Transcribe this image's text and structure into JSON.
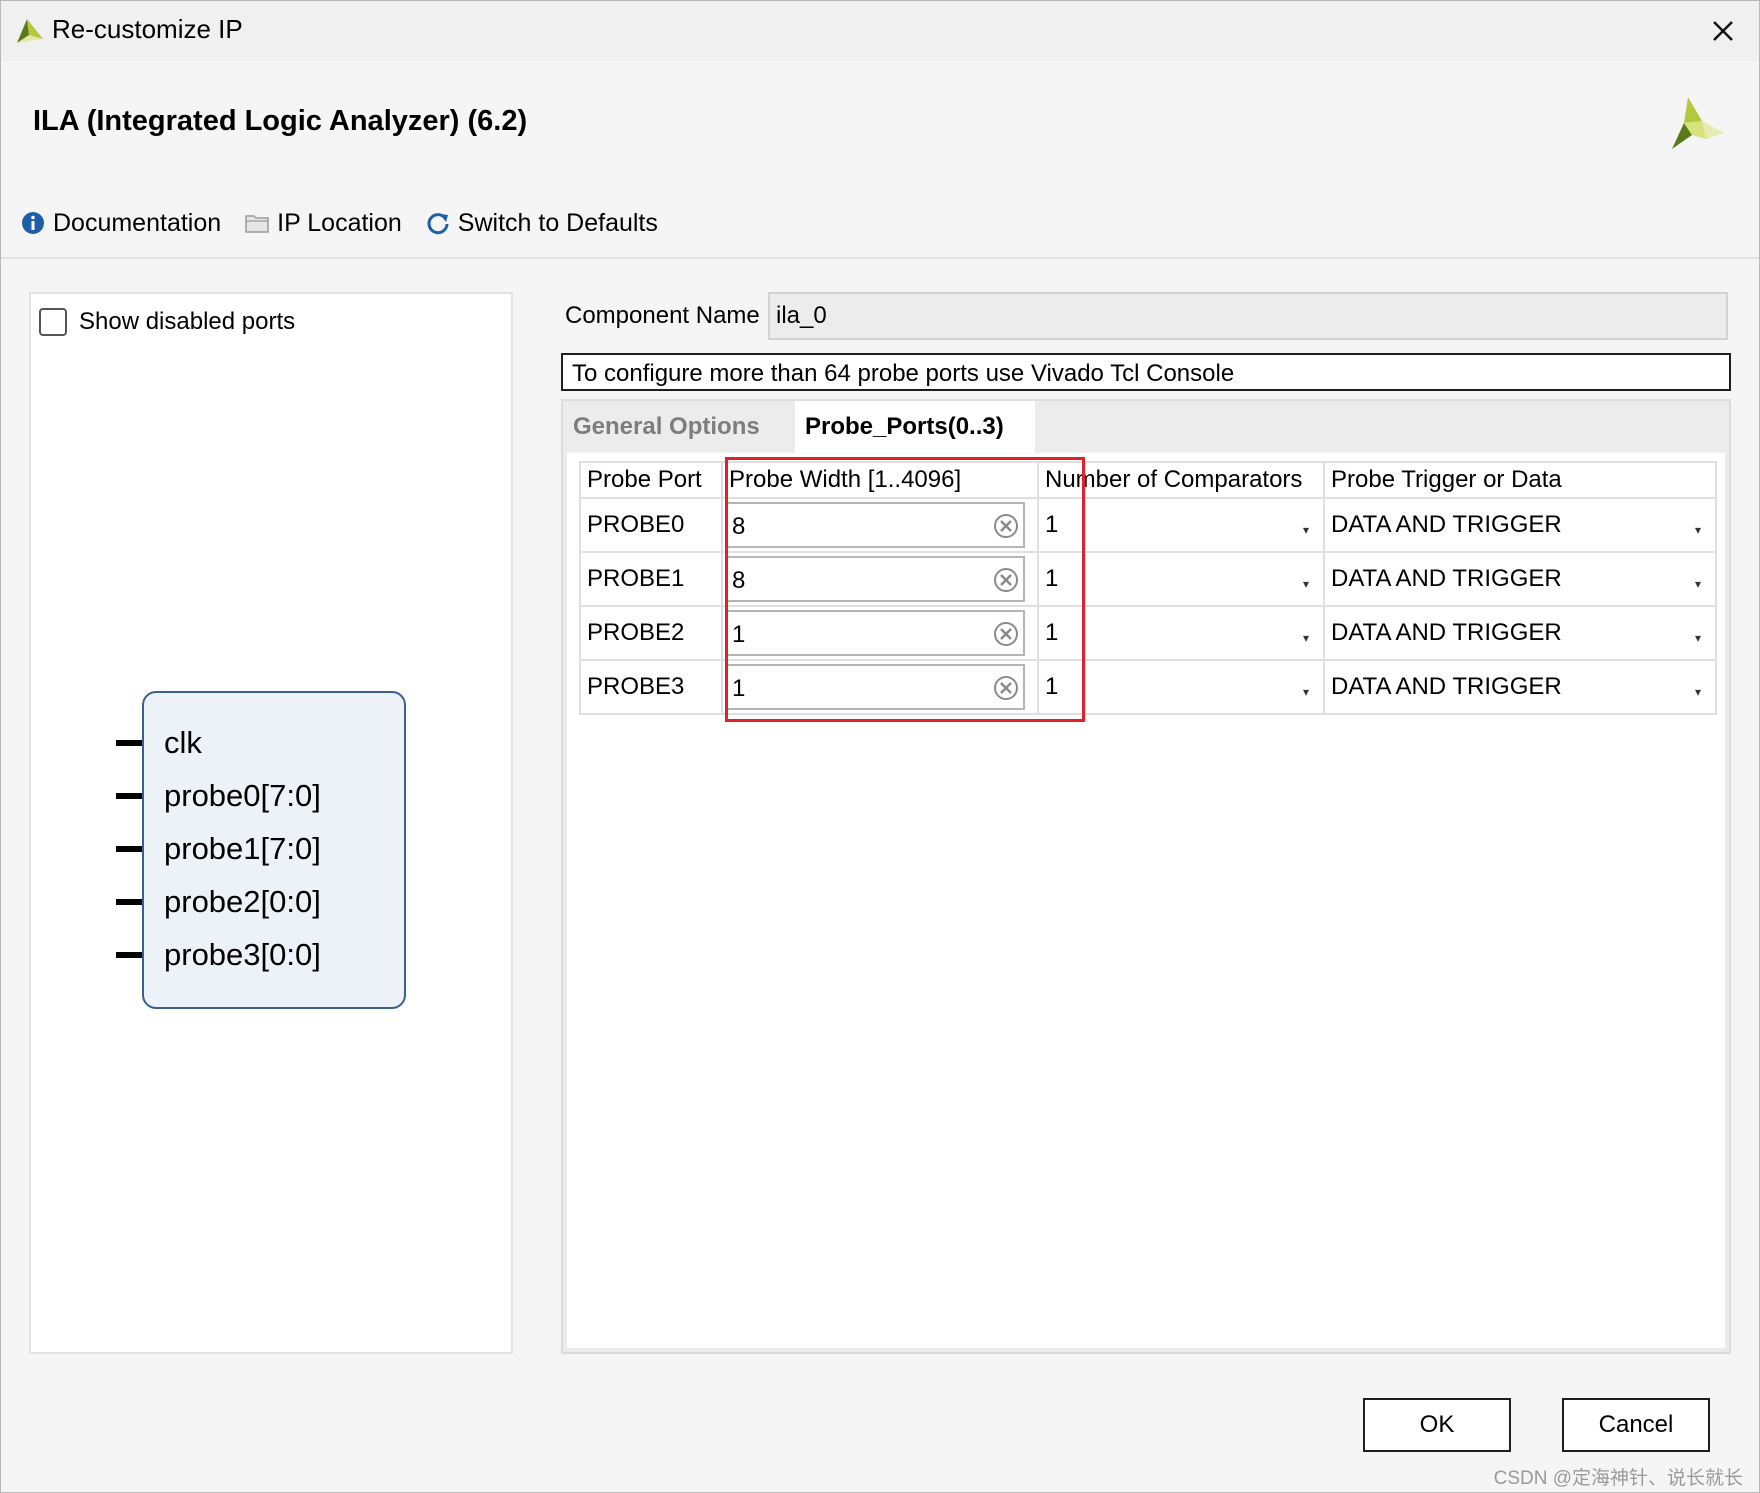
{
  "window": {
    "title": "Re-customize IP",
    "icon": "vivado-logo-icon",
    "close_icon": "close-icon"
  },
  "header": {
    "ip_title": "ILA (Integrated Logic Analyzer) (6.2)",
    "brand_icon": "xilinx-logo-icon",
    "toolbar": {
      "documentation": "Documentation",
      "ip_location": "IP Location",
      "switch_defaults": "Switch to Defaults"
    }
  },
  "left_panel": {
    "show_disabled_ports": "Show disabled ports",
    "show_disabled_checked": false,
    "ports": [
      "clk",
      "probe0[7:0]",
      "probe1[7:0]",
      "probe2[0:0]",
      "probe3[0:0]"
    ]
  },
  "right_panel": {
    "component_name_label": "Component Name",
    "component_name_value": "ila_0",
    "info_text": "To configure more than 64 probe ports use Vivado Tcl Console",
    "tabs": [
      "General Options",
      "Probe_Ports(0..3)"
    ],
    "active_tab": "Probe_Ports(0..3)",
    "table": {
      "headers": [
        "Probe Port",
        "Probe Width [1..4096]",
        "Number of Comparators",
        "Probe Trigger or Data"
      ],
      "rows": [
        {
          "port": "PROBE0",
          "width": "8",
          "comparators": "1",
          "trigger": "DATA AND TRIGGER"
        },
        {
          "port": "PROBE1",
          "width": "8",
          "comparators": "1",
          "trigger": "DATA AND TRIGGER"
        },
        {
          "port": "PROBE2",
          "width": "1",
          "comparators": "1",
          "trigger": "DATA AND TRIGGER"
        },
        {
          "port": "PROBE3",
          "width": "1",
          "comparators": "1",
          "trigger": "DATA AND TRIGGER"
        }
      ]
    }
  },
  "buttons": {
    "ok": "OK",
    "cancel": "Cancel"
  },
  "watermark": "CSDN @定海神针、说长就长",
  "colors": {
    "highlight": "#e0232b",
    "symbol_border": "#3a5f8e",
    "symbol_fill": "#edf2f8",
    "info_icon": "#1f5fa8"
  }
}
